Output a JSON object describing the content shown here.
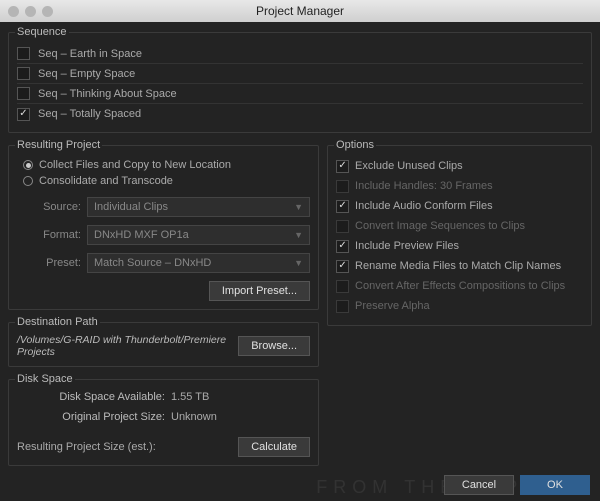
{
  "window": {
    "title": "Project Manager"
  },
  "sequence": {
    "legend": "Sequence",
    "items": [
      {
        "label": "Seq – Earth in Space",
        "checked": false
      },
      {
        "label": "Seq – Empty Space",
        "checked": false
      },
      {
        "label": "Seq – Thinking About Space",
        "checked": false
      },
      {
        "label": "Seq – Totally Spaced",
        "checked": true
      }
    ]
  },
  "resulting": {
    "legend": "Resulting Project",
    "radio": {
      "collect": "Collect Files and Copy to New Location",
      "consolidate": "Consolidate and Transcode"
    },
    "form": {
      "source_lbl": "Source:",
      "source_val": "Individual Clips",
      "format_lbl": "Format:",
      "format_val": "DNxHD MXF OP1a",
      "preset_lbl": "Preset:",
      "preset_val": "Match Source – DNxHD"
    },
    "import_btn": "Import Preset..."
  },
  "options": {
    "legend": "Options",
    "items": [
      {
        "label": "Exclude Unused Clips",
        "checked": true,
        "enabled": true
      },
      {
        "label": "Include Handles:  30 Frames",
        "checked": false,
        "enabled": false
      },
      {
        "label": "Include Audio Conform Files",
        "checked": true,
        "enabled": true
      },
      {
        "label": "Convert Image Sequences to Clips",
        "checked": false,
        "enabled": false
      },
      {
        "label": "Include Preview Files",
        "checked": true,
        "enabled": true
      },
      {
        "label": "Rename Media Files to Match Clip Names",
        "checked": true,
        "enabled": true
      },
      {
        "label": "Convert After Effects Compositions to Clips",
        "checked": false,
        "enabled": false
      },
      {
        "label": "Preserve Alpha",
        "checked": false,
        "enabled": false
      }
    ]
  },
  "destination": {
    "legend": "Destination Path",
    "path": "/Volumes/G-RAID with Thunderbolt/Premiere Projects",
    "browse": "Browse..."
  },
  "diskspace": {
    "legend": "Disk Space",
    "avail_lbl": "Disk Space Available:",
    "avail_val": "1.55 TB",
    "orig_lbl": "Original Project Size:",
    "orig_val": "Unknown",
    "result_lbl": "Resulting Project Size (est.):",
    "calc_btn": "Calculate"
  },
  "footer": {
    "cancel": "Cancel",
    "ok": "OK"
  }
}
